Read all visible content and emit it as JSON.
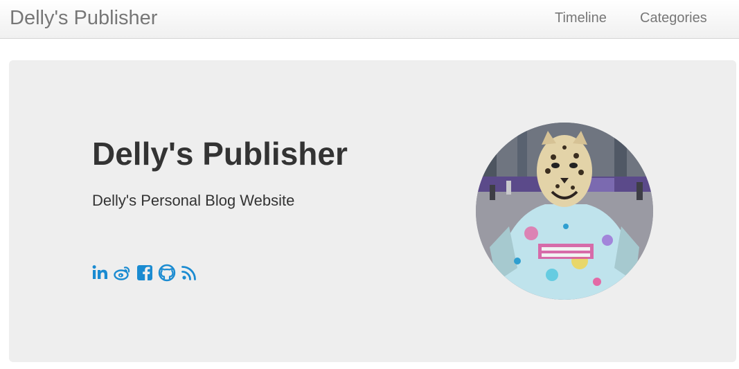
{
  "navbar": {
    "brand": "Delly's Publisher",
    "links": [
      {
        "label": "Timeline"
      },
      {
        "label": "Categories"
      }
    ]
  },
  "hero": {
    "title": "Delly's Publisher",
    "subtitle": "Delly's Personal Blog Website",
    "social_icons": [
      "linkedin-icon",
      "weibo-icon",
      "facebook-icon",
      "github-icon",
      "rss-icon"
    ],
    "accent_color": "#1a8bd1"
  },
  "avatar": {
    "description_icon": "profile-photo"
  }
}
